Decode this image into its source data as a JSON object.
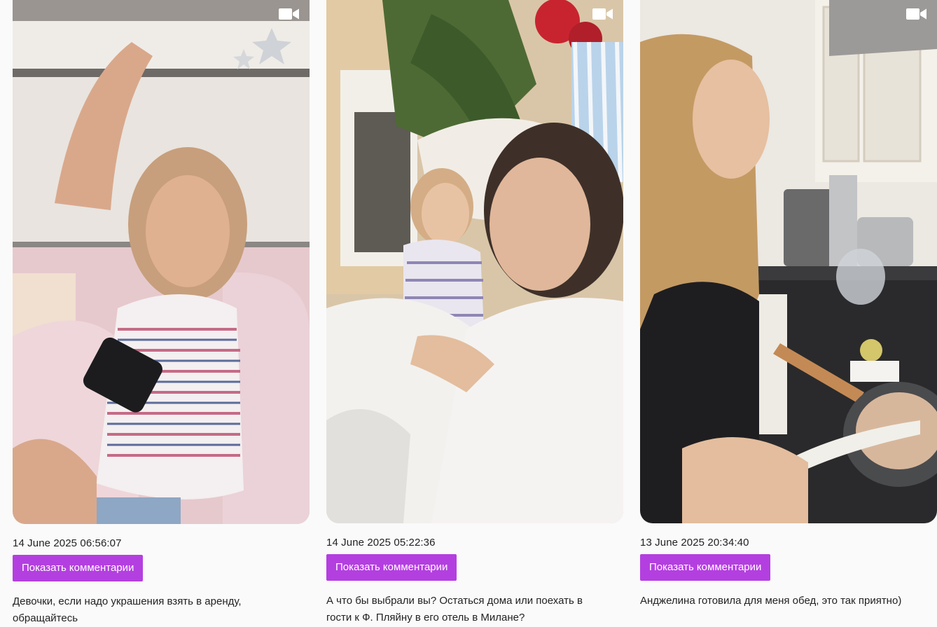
{
  "posts": [
    {
      "date": "14 June 2025 06:56:07",
      "button_label": "Показать комментарии",
      "caption": "Девочки, если надо украшения взять в аренду, обращайтесь ",
      "media_icon": "video-camera-icon"
    },
    {
      "date": "14 June 2025 05:22:36",
      "button_label": "Показать комментарии",
      "caption": "А что бы выбрали вы? Остаться дома или поехать в гости к Ф. Пляйну в его отель в Милане?",
      "media_icon": "video-camera-icon"
    },
    {
      "date": "13 June 2025 20:34:40",
      "button_label": "Показать комментарии",
      "caption": "Анджелина готовила для меня обед, это так приятно)",
      "media_icon": "video-camera-icon"
    }
  ],
  "colors": {
    "button_bg": "#b43fe0",
    "page_bg": "#fafafa"
  }
}
